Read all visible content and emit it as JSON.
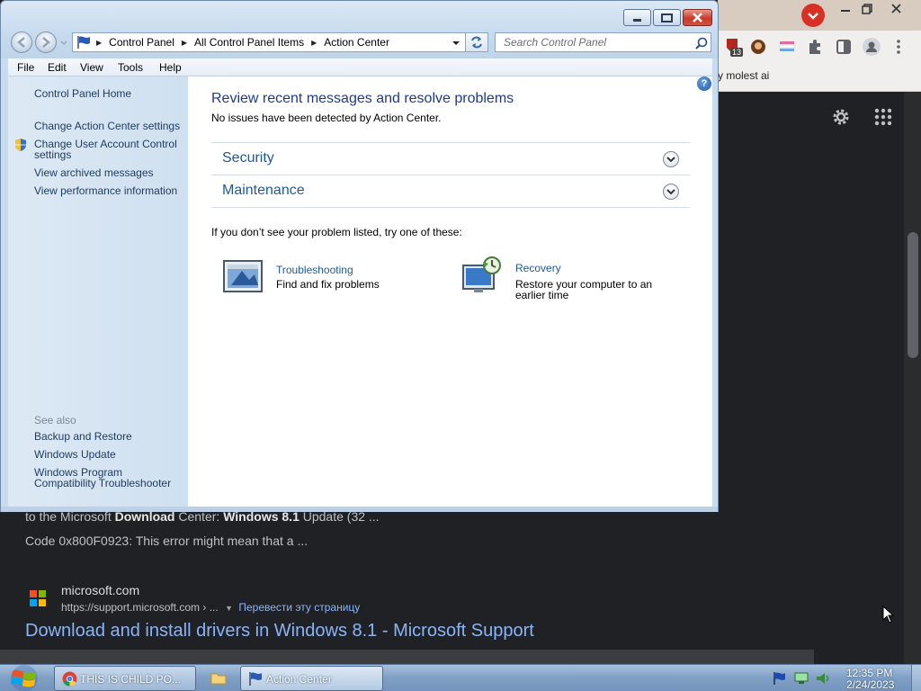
{
  "browser": {
    "extension_badge": "13",
    "bookmark_text": "y molest ai",
    "snippet_line1_pre": "to the Microsoft ",
    "snippet_line1_b1": "Download",
    "snippet_line1_mid": " Center: ",
    "snippet_line1_b2": "Windows 8.1",
    "snippet_line1_post": " Update (32 ...",
    "snippet_line2": "Code 0x800F0923: This error might mean that a ...",
    "result_site": "microsoft.com",
    "result_url": "https://support.microsoft.com › ...",
    "result_translate": "Перевести эту страницу",
    "result_title": "Download and install drivers in Windows 8.1 - Microsoft Support"
  },
  "window": {
    "breadcrumbs": [
      "Control Panel",
      "All Control Panel Items",
      "Action Center"
    ],
    "search_placeholder": "Search Control Panel",
    "menu": [
      "File",
      "Edit",
      "View",
      "Tools",
      "Help"
    ],
    "left_links": {
      "home": "Control Panel Home",
      "change_settings": "Change Action Center settings",
      "uac_line1": "Change User Account Control",
      "uac_line2": "settings",
      "archived": "View archived messages",
      "performance": "View performance information"
    },
    "see_also": {
      "heading": "See also",
      "backup": "Backup and Restore",
      "update": "Windows Update",
      "compat_line1": "Windows Program",
      "compat_line2": "Compatibility Troubleshooter"
    },
    "main": {
      "heading": "Review recent messages and resolve problems",
      "status": "No issues have been detected by Action Center.",
      "sections": [
        "Security",
        "Maintenance"
      ],
      "try_text": "If you don’t see your problem listed, try one of these:",
      "tools": [
        {
          "title": "Troubleshooting",
          "desc_line1": "Find and fix problems",
          "desc_line2": ""
        },
        {
          "title": "Recovery",
          "desc_line1": "Restore your computer to an",
          "desc_line2": "earlier time"
        }
      ]
    }
  },
  "taskbar": {
    "buttons": [
      "THIS IS CHILD PO...",
      "Action Center"
    ],
    "time": "12:35 PM",
    "date": "2/24/2023"
  }
}
